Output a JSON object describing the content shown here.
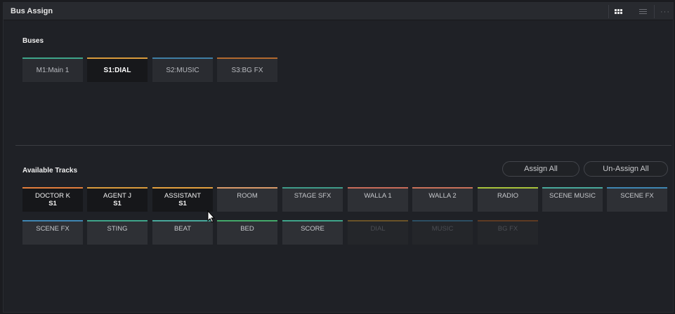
{
  "window": {
    "title": "Bus Assign",
    "view_icons": [
      "grid-view-icon",
      "list-view-icon",
      "more-options-icon"
    ]
  },
  "buses_section": {
    "label": "Buses",
    "buses": [
      {
        "label": "M1:Main 1",
        "color": "#3ea58a",
        "selected": false
      },
      {
        "label": "S1:DIAL",
        "color": "#d99b3c",
        "selected": true
      },
      {
        "label": "S2:MUSIC",
        "color": "#3f7fa6",
        "selected": false
      },
      {
        "label": "S3:BG FX",
        "color": "#b2692e",
        "selected": false
      }
    ]
  },
  "tracks_section": {
    "label": "Available Tracks",
    "assign_all_label": "Assign All",
    "unassign_all_label": "Un-Assign All",
    "tracks": [
      {
        "label": "DOCTOR K",
        "sub": "S1",
        "color": "#e27e3c",
        "state": "assigned"
      },
      {
        "label": "AGENT J",
        "sub": "S1",
        "color": "#d99b3c",
        "state": "assigned"
      },
      {
        "label": "ASSISTANT",
        "sub": "S1",
        "color": "#e3a03f",
        "state": "assigned"
      },
      {
        "label": "ROOM",
        "sub": "",
        "color": "#d89a6a",
        "state": "normal"
      },
      {
        "label": "STAGE SFX",
        "sub": "",
        "color": "#3f9c8a",
        "state": "normal"
      },
      {
        "label": "WALLA 1",
        "sub": "",
        "color": "#c96c5a",
        "state": "normal"
      },
      {
        "label": "WALLA 2",
        "sub": "",
        "color": "#c9715a",
        "state": "normal"
      },
      {
        "label": "RADIO",
        "sub": "",
        "color": "#a8c43c",
        "state": "normal"
      },
      {
        "label": "SCENE MUSIC",
        "sub": "",
        "color": "#49a89b",
        "state": "normal"
      },
      {
        "label": "SCENE FX",
        "sub": "",
        "color": "#3f86b3",
        "state": "normal"
      },
      {
        "label": "SCENE FX",
        "sub": "",
        "color": "#3f86b3",
        "state": "normal"
      },
      {
        "label": "STING",
        "sub": "",
        "color": "#3fa58a",
        "state": "normal"
      },
      {
        "label": "BEAT",
        "sub": "",
        "color": "#49a89b",
        "state": "normal"
      },
      {
        "label": "BED",
        "sub": "",
        "color": "#43a96a",
        "state": "normal"
      },
      {
        "label": "SCORE",
        "sub": "",
        "color": "#3fa58a",
        "state": "normal"
      },
      {
        "label": "DIAL",
        "sub": "",
        "color": "#6a5227",
        "state": "dim"
      },
      {
        "label": "MUSIC",
        "sub": "",
        "color": "#2c4e63",
        "state": "dim"
      },
      {
        "label": "BG FX",
        "sub": "",
        "color": "#5e3a22",
        "state": "dim"
      }
    ]
  }
}
